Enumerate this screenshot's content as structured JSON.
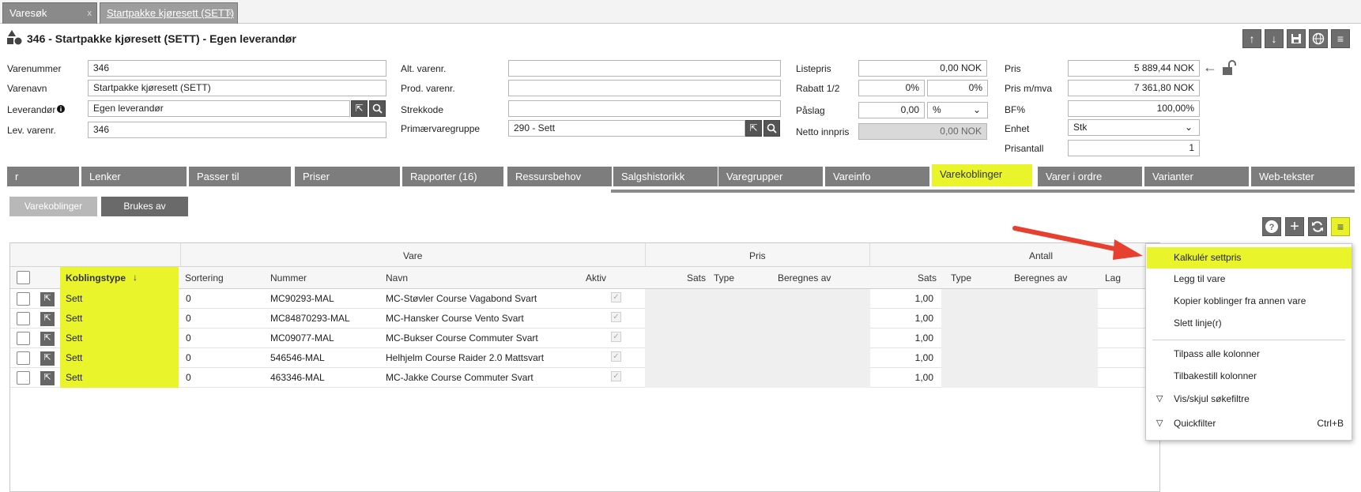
{
  "doc_tabs": [
    {
      "label": "Varesøk",
      "close": "x"
    },
    {
      "label": "Startpakke kjøresett (SETT)",
      "close": "x"
    }
  ],
  "header": {
    "title": "346 - Startpakke kjøresett (SETT) - Egen leverandør"
  },
  "form": {
    "varenummer": {
      "label": "Varenummer",
      "value": "346"
    },
    "varenavn": {
      "label": "Varenavn",
      "value": "Startpakke kjøresett (SETT)"
    },
    "leverandor": {
      "label": "Leverandør",
      "value": "Egen leverandør"
    },
    "lev_varenr": {
      "label": "Lev. varenr.",
      "value": "346"
    },
    "alt_varenr": {
      "label": "Alt. varenr.",
      "value": ""
    },
    "prod_varenr": {
      "label": "Prod. varenr.",
      "value": ""
    },
    "strekkode": {
      "label": "Strekkode",
      "value": ""
    },
    "primaervaregruppe": {
      "label": "Primærvaregruppe",
      "value": "290 - Sett"
    },
    "listepris": {
      "label": "Listepris",
      "value": "0,00",
      "unit": "NOK"
    },
    "rabatt": {
      "label": "Rabatt 1/2",
      "value1": "0%",
      "value2": "0%"
    },
    "paslag": {
      "label": "Påslag",
      "value": "0,00",
      "unit": "%"
    },
    "netto_innpris": {
      "label": "Netto innpris",
      "value": "0,00 NOK"
    },
    "pris": {
      "label": "Pris",
      "value": "5 889,44",
      "unit": "NOK"
    },
    "pris_mva": {
      "label": "Pris m/mva",
      "value": "7 361,80",
      "unit": "NOK"
    },
    "bf": {
      "label": "BF%",
      "value": "100,00%"
    },
    "enhet": {
      "label": "Enhet",
      "value": "Stk"
    },
    "prisantall": {
      "label": "Prisantall",
      "value": "1"
    }
  },
  "page_tabs": [
    "r",
    "Lenker",
    "Passer til",
    "Priser",
    "Rapporter (16)",
    "Ressursbehov",
    "Salgshistorikk",
    "Varegrupper",
    "Vareinfo",
    "Varekoblinger",
    "Varer i ordre",
    "Varianter",
    "Web-tekster"
  ],
  "sub_tabs": [
    "Varekoblinger",
    "Brukes av"
  ],
  "grid": {
    "groups": {
      "vare": "Vare",
      "pris": "Pris",
      "antall": "Antall"
    },
    "columns": {
      "koblingstype": "Koblingstype",
      "sortering": "Sortering",
      "nummer": "Nummer",
      "navn": "Navn",
      "aktiv": "Aktiv",
      "sats": "Sats",
      "type": "Type",
      "beregnes_av": "Beregnes av",
      "sats2": "Sats",
      "type2": "Type",
      "beregnes_av2": "Beregnes av",
      "lag": "Lag"
    },
    "sort_arrow": "↓",
    "rows": [
      {
        "koblingstype": "Sett",
        "sortering": "0",
        "nummer": "MC90293-MAL",
        "navn": "MC-Støvler Course Vagabond Svart",
        "antall": "1,00"
      },
      {
        "koblingstype": "Sett",
        "sortering": "0",
        "nummer": "MC84870293-MAL",
        "navn": "MC-Hansker Course Vento Svart",
        "antall": "1,00"
      },
      {
        "koblingstype": "Sett",
        "sortering": "0",
        "nummer": "MC09077-MAL",
        "navn": "MC-Bukser Course Commuter Svart",
        "antall": "1,00"
      },
      {
        "koblingstype": "Sett",
        "sortering": "0",
        "nummer": "546546-MAL",
        "navn": "Helhjelm Course Raider 2.0 Mattsvart",
        "antall": "1,00"
      },
      {
        "koblingstype": "Sett",
        "sortering": "0",
        "nummer": "463346-MAL",
        "navn": "MC-Jakke Course Commuter Svart",
        "antall": "1,00"
      }
    ]
  },
  "context_menu": {
    "items": [
      {
        "label": "Kalkulér settpris"
      },
      {
        "label": "Legg til vare"
      },
      {
        "label": "Kopier koblinger fra annen vare"
      },
      {
        "label": "Slett linje(r)"
      },
      {
        "label": "Tilpass alle kolonner"
      },
      {
        "label": "Tilbakestill kolonner"
      },
      {
        "label": "Vis/skjul søkefiltre"
      },
      {
        "label": "Quickfilter",
        "shortcut": "Ctrl+B"
      }
    ]
  },
  "colors": {
    "highlight": "#eaf42a",
    "arrow": "#e8402f",
    "tab": "#7d7d7d"
  }
}
